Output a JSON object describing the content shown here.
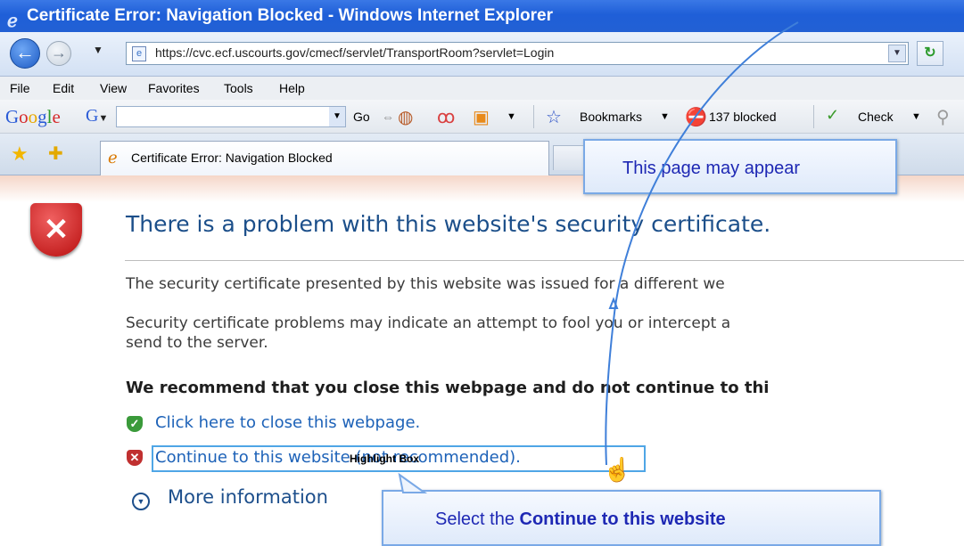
{
  "window": {
    "title": "Certificate Error: Navigation Blocked - Windows Internet Explorer",
    "title_icon": "ie-logo-icon"
  },
  "address_bar": {
    "url": "https://cvc.ecf.uscourts.gov/cmecf/servlet/TransportRoom?servlet=Login",
    "back_icon": "back-arrow-icon",
    "forward_icon": "forward-arrow-icon",
    "dropdown_glyph": "▼",
    "refresh_glyph": "↻"
  },
  "menu": {
    "items": [
      "File",
      "Edit",
      "View",
      "Favorites",
      "Tools",
      "Help"
    ]
  },
  "google_toolbar": {
    "logo": "Google",
    "g_button": "G",
    "go_label": "Go",
    "bookmarks_label": "Bookmarks",
    "blocked_label": "137 blocked",
    "check_label": "Check"
  },
  "tabs": {
    "active_tab_label": "Certificate Error: Navigation Blocked"
  },
  "page": {
    "headline": "There is a problem with this website's security certificate.",
    "para1": "The security certificate presented by this website was issued for a different we",
    "para2_line1": "Security certificate problems may indicate an attempt to fool you or intercept a",
    "para2_line2": "send to the server.",
    "recommend": "We recommend that you close this webpage and do not continue to thi",
    "close_link": "Click here to close this webpage.",
    "continue_link": "Continue to this website (not recommended).",
    "more_info": "More information"
  },
  "annotations": {
    "highlight_label": "Highlight Box",
    "callout_top": "This page may appear",
    "callout_bottom_prefix": "Select the ",
    "callout_bottom_bold": "Continue to this website"
  },
  "colors": {
    "title_bar": "#1f5fd8",
    "link": "#1d62b8",
    "headline": "#1c4f8a",
    "callout_text": "#1e28b4",
    "arrow": "#3f7fd9"
  }
}
